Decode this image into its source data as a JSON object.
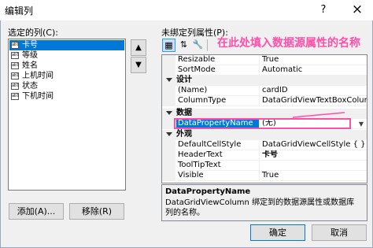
{
  "window": {
    "title": "编辑列",
    "help": "?",
    "close": "×"
  },
  "left": {
    "label": "选定的列(C):",
    "icon_text": "abl",
    "columns": [
      "卡号",
      "等级",
      "姓名",
      "上机时间",
      "状态",
      "下机时间"
    ],
    "selected_index": 0,
    "add_label": "添加(A)...",
    "remove_label": "移除(R)"
  },
  "right": {
    "label": "未绑定列属性(P):",
    "annotation": "在此处填入数据源属性的名称",
    "categories": [
      "设计",
      "数据",
      "外观"
    ],
    "rows": [
      {
        "name": "Resizable",
        "value": "True"
      },
      {
        "name": "SortMode",
        "value": "Automatic"
      },
      {
        "name": "(Name)",
        "value": "cardID"
      },
      {
        "name": "ColumnType",
        "value": "DataGridViewTextBoxColumn"
      },
      {
        "name": "DataPropertyName",
        "value": "(无)"
      },
      {
        "name": "DefaultCellStyle",
        "value": "DataGridViewCellStyle { }"
      },
      {
        "name": "HeaderText",
        "value": "卡号"
      },
      {
        "name": "ToolTipText",
        "value": ""
      },
      {
        "name": "Visible",
        "value": "True"
      }
    ],
    "description": {
      "title": "DataPropertyName",
      "text": "DataGridViewColumn 绑定到的数据源属性或数据库列的名称。"
    }
  },
  "buttons": {
    "ok": "确定",
    "cancel": "取消"
  }
}
